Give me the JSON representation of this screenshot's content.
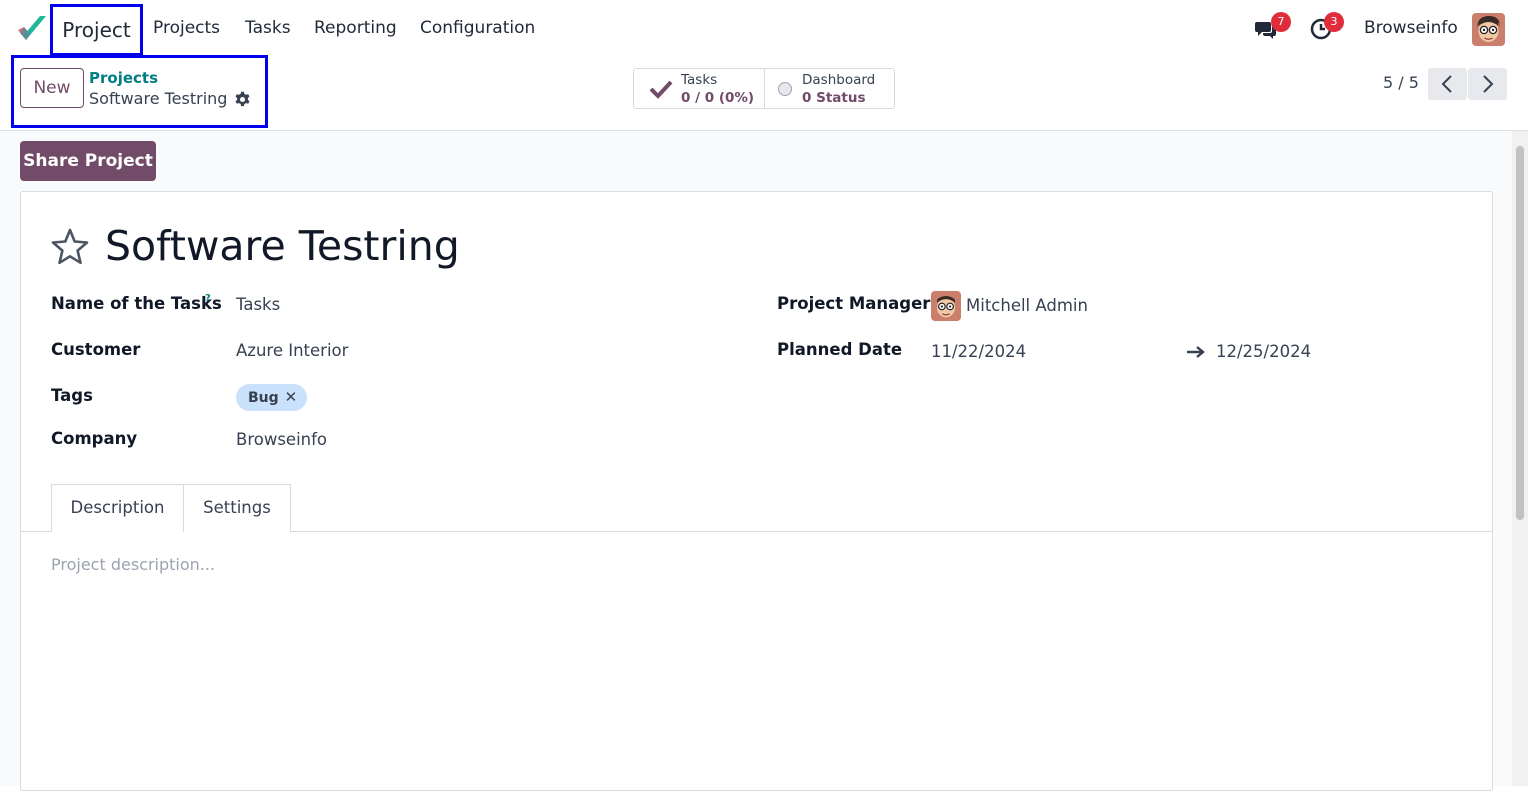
{
  "navbar": {
    "app_name": "Project",
    "menu": [
      "Projects",
      "Tasks",
      "Reporting",
      "Configuration"
    ],
    "messages_count": "7",
    "activities_count": "3",
    "company": "Browseinfo"
  },
  "control_panel": {
    "new_label": "New",
    "breadcrumb_parent": "Projects",
    "breadcrumb_current": "Software Testring",
    "pager": "5 / 5"
  },
  "stats": {
    "tasks": {
      "label": "Tasks",
      "value": "0 / 0 (0%)"
    },
    "dashboard": {
      "label": "Dashboard",
      "value": "0 Status"
    }
  },
  "actions": {
    "share_label": "Share Project"
  },
  "form": {
    "title": "Software Testring",
    "fields": {
      "task_name_label": "Name of the Tasks",
      "task_name_help": "?",
      "task_name_value": "Tasks",
      "customer_label": "Customer",
      "customer_value": "Azure Interior",
      "tags_label": "Tags",
      "tag": "Bug",
      "company_label": "Company",
      "company_value": "Browseinfo",
      "manager_label": "Project Manager",
      "manager_value": "Mitchell Admin",
      "planned_label": "Planned Date",
      "date_start": "11/22/2024",
      "date_end": "12/25/2024"
    },
    "tabs": [
      "Description",
      "Settings"
    ],
    "description_placeholder": "Project description..."
  },
  "colors": {
    "brand": "#714b67",
    "link": "#017e84",
    "badge": "#e02d3c",
    "highlight": "#0000ee"
  }
}
